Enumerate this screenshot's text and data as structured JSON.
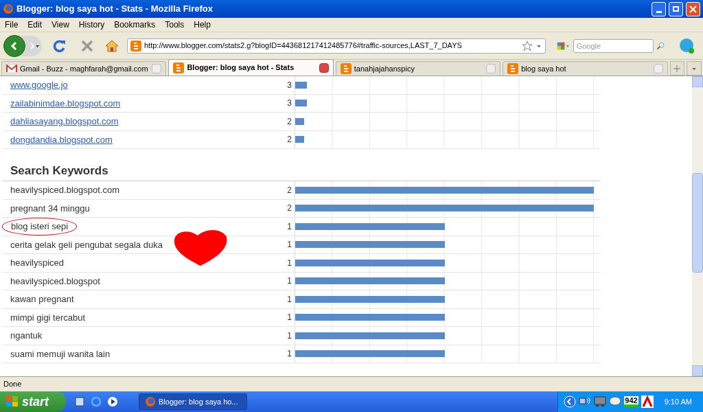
{
  "window": {
    "title": "Blogger: blog saya hot - Stats - Mozilla Firefox"
  },
  "menu": [
    "File",
    "Edit",
    "View",
    "History",
    "Bookmarks",
    "Tools",
    "Help"
  ],
  "address_bar": {
    "value": "http://www.blogger.com/stats2.g?blogID=443681217412485776#traffic-sources,LAST_7_DAYS"
  },
  "search": {
    "placeholder": "Google"
  },
  "tabs": [
    {
      "label": "Gmail - Buzz - maghfarah@gmail.com",
      "kind": "gmail",
      "selected": false
    },
    {
      "label": "Blogger: blog saya hot - Stats",
      "kind": "blogger",
      "selected": true
    },
    {
      "label": "tanahjajahanspicy",
      "kind": "blogger",
      "selected": false
    },
    {
      "label": "blog saya hot",
      "kind": "blogger",
      "selected": false
    }
  ],
  "referring_sites": [
    {
      "name": "www.google.jo",
      "count": "3",
      "level": 0.04
    },
    {
      "name": "zailabinimdae.blogspot.com",
      "count": "3",
      "level": 0.04
    },
    {
      "name": "dahliasayang.blogspot.com",
      "count": "2",
      "level": 0.03
    },
    {
      "name": "dongdandia.blogspot.com",
      "count": "2",
      "level": 0.03
    }
  ],
  "search_keywords": {
    "title": "Search Keywords",
    "rows": [
      {
        "keyword": "heavilyspiced.blogspot.com",
        "count": "2",
        "level": 1
      },
      {
        "keyword": "pregnant 34 minggu",
        "count": "2",
        "level": 1
      },
      {
        "keyword": "blog isteri sepi",
        "count": "1",
        "level": 0.5
      },
      {
        "keyword": "cerita gelak geli pengubat segala duka",
        "count": "1",
        "level": 0.5
      },
      {
        "keyword": "heavilyspiced",
        "count": "1",
        "level": 0.5
      },
      {
        "keyword": "heavilyspiced.blogspot",
        "count": "1",
        "level": 0.5
      },
      {
        "keyword": "kawan pregnant",
        "count": "1",
        "level": 0.5
      },
      {
        "keyword": "mimpi gigi tercabut",
        "count": "1",
        "level": 0.5
      },
      {
        "keyword": "ngantuk",
        "count": "1",
        "level": 0.5
      },
      {
        "keyword": "suami memuji wanita lain",
        "count": "1",
        "level": 0.5
      }
    ]
  },
  "status_bar": {
    "text": "Done"
  },
  "taskbar": {
    "start": "start",
    "task": "Blogger: blog saya ho...",
    "tray_badge": "942",
    "clock": "9:10 AM"
  }
}
